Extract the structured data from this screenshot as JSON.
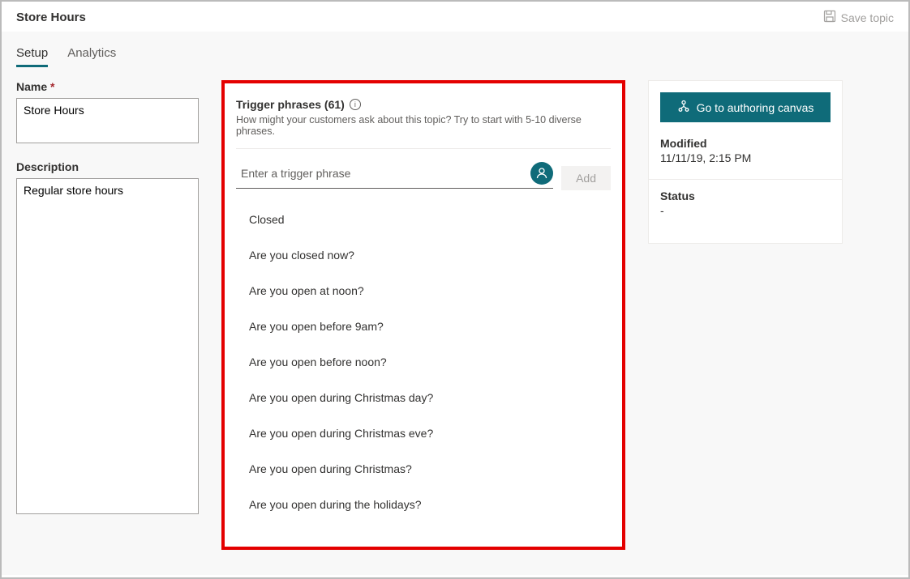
{
  "topbar": {
    "title": "Store Hours",
    "save_label": "Save topic"
  },
  "tabs": {
    "setup": "Setup",
    "analytics": "Analytics"
  },
  "left": {
    "name_label": "Name",
    "name_value": "Store Hours",
    "description_label": "Description",
    "description_value": "Regular store hours"
  },
  "center": {
    "title": "Trigger phrases (61)",
    "subtext": "How might your customers ask about this topic? Try to start with 5-10 diverse phrases.",
    "input_placeholder": "Enter a trigger phrase",
    "add_label": "Add",
    "phrases": [
      "Closed",
      "Are you closed now?",
      "Are you open at noon?",
      "Are you open before 9am?",
      "Are you open before noon?",
      "Are you open during Christmas day?",
      "Are you open during Christmas eve?",
      "Are you open during Christmas?",
      "Are you open during the holidays?"
    ]
  },
  "right": {
    "goto_label": "Go to authoring canvas",
    "modified_label": "Modified",
    "modified_value": "11/11/19, 2:15 PM",
    "status_label": "Status",
    "status_value": "-"
  }
}
